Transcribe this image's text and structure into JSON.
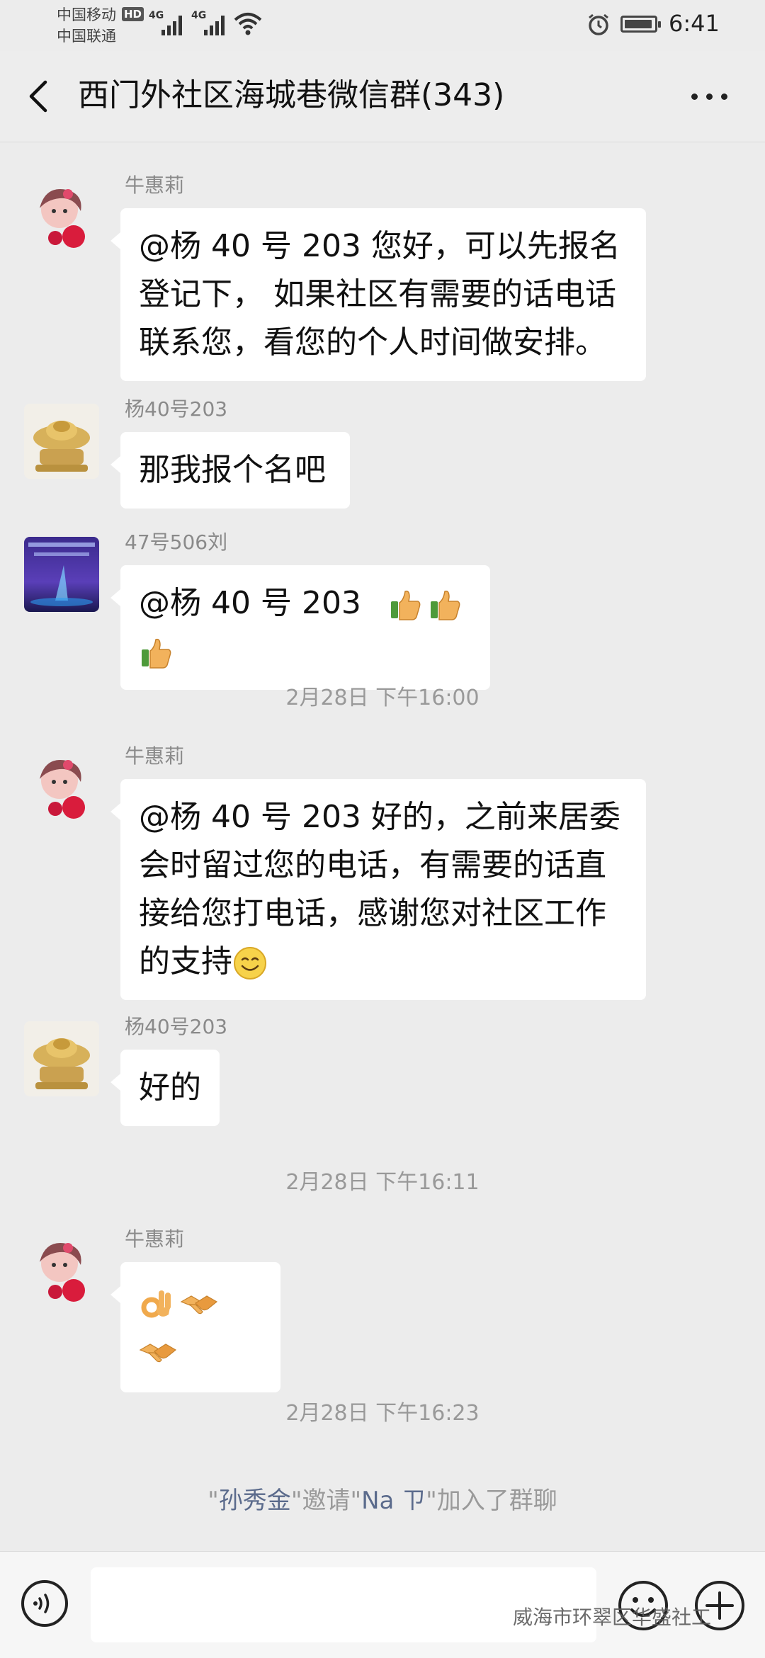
{
  "status_bar": {
    "carrier_1": "中国移动",
    "carrier_2": "中国联通",
    "hd_badge": "HD",
    "network_1": "4G",
    "network_2": "4G",
    "time": "6:41"
  },
  "header": {
    "title": "西门外社区海城巷微信群(343)"
  },
  "messages": [
    {
      "sender": "牛惠莉",
      "text": "@杨 40 号 203  您好，可以先报名登记下， 如果社区有需要的话电话联系您，看您的个人时间做安排。"
    },
    {
      "sender": "杨40号203",
      "text": "那我报个名吧"
    },
    {
      "sender": "47号506刘",
      "text": "@杨 40 号 203",
      "emojis": [
        "thumbs-up",
        "thumbs-up",
        "thumbs-up"
      ]
    },
    {
      "sender": "牛惠莉",
      "text": "@杨 40 号 203  好的，之前来居委会时留过您的电话，有需要的话直接给您打电话，感谢您对社区工作的支持",
      "emojis": [
        "smile"
      ]
    },
    {
      "sender": "杨40号203",
      "text": "好的"
    },
    {
      "sender": "牛惠莉",
      "text": "",
      "emojis": [
        "ok-hand",
        "handshake",
        "handshake"
      ]
    }
  ],
  "timestamps": [
    "2月28日 下午16:00",
    "2月28日 下午16:11",
    "2月28日 下午16:23"
  ],
  "system_notice": {
    "q1": "\"",
    "inviter": "孙秀金",
    "mid": "\"邀请\"",
    "invitee": "Na ㄗ",
    "tail": "\"加入了群聊"
  },
  "input_bar": {
    "placeholder": "",
    "icons": [
      "voice-icon",
      "emoji-icon",
      "plus-icon"
    ]
  },
  "watermark": "威海市环翠区华盛社工",
  "colors": {
    "background": "#ececec",
    "bubble": "#ffffff",
    "system_name": "#5b6b8c"
  }
}
